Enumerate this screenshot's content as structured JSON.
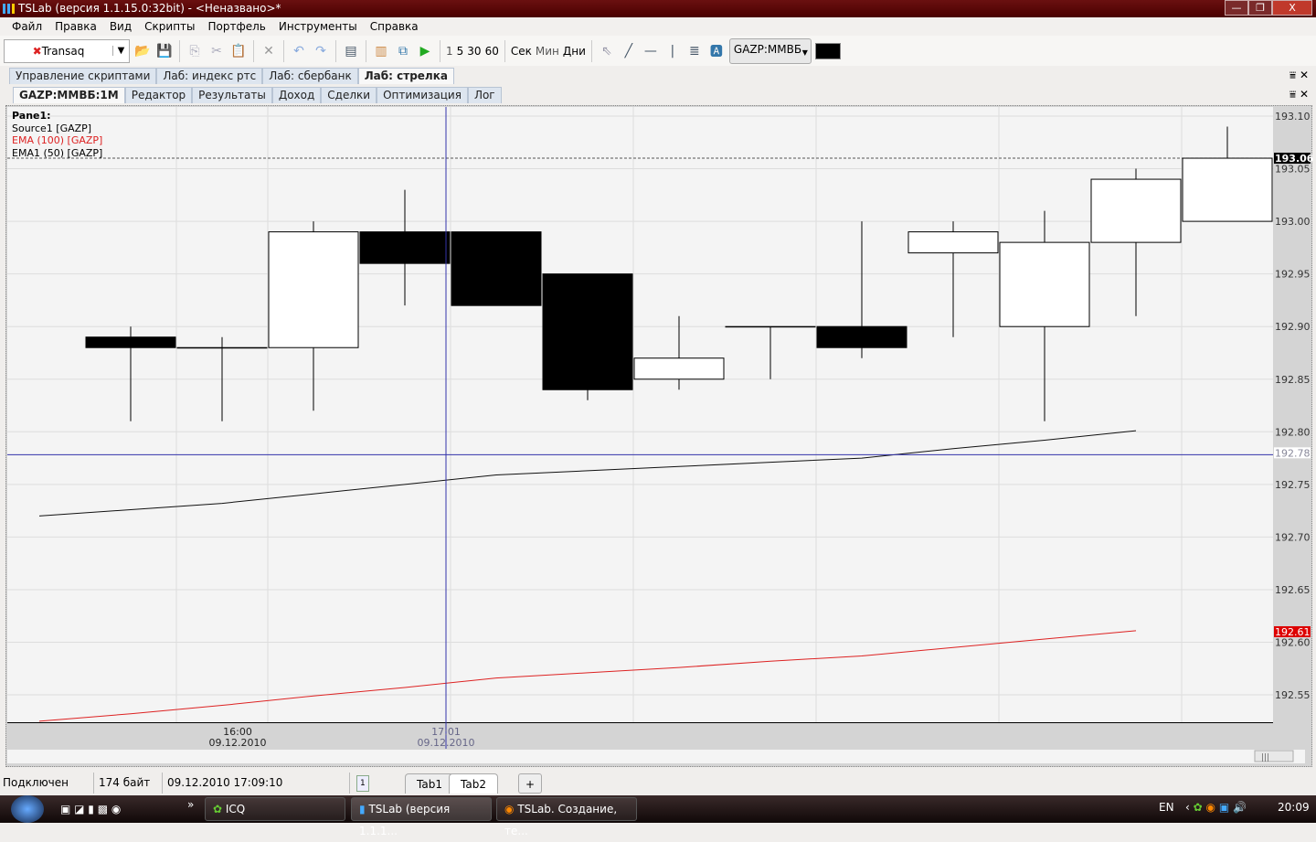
{
  "window": {
    "title": "TSLab (версия 1.1.15.0:32bit) - <Неназвано>*",
    "min": "—",
    "restore": "❐",
    "close": "X"
  },
  "menu": [
    "Файл",
    "Правка",
    "Вид",
    "Скрипты",
    "Портфель",
    "Инструменты",
    "Справка"
  ],
  "toolbar": {
    "connection": "Transaq",
    "intervals": [
      "1",
      "5",
      "30",
      "60"
    ],
    "units": [
      "Сек",
      "Мин",
      "Дни"
    ],
    "symbol": "GAZP:MMBБ",
    "color": "#000000"
  },
  "tabs": [
    "Управление скриптами",
    "Лаб: индекс ртс",
    "Лаб: сбербанк",
    "Лаб: стрелка"
  ],
  "subtabs": [
    "GAZP:MMBБ:1M",
    "Редактор",
    "Результаты",
    "Доход",
    "Сделки",
    "Оптимизация",
    "Лог"
  ],
  "pane_controls": {
    "pin": "⩸",
    "close": "✕"
  },
  "legend": {
    "pane": "Pane1:",
    "source": "Source1 [GAZP]",
    "ema100": "EMA (100) [GAZP]",
    "ema50": "EMA1 (50) [GAZP]"
  },
  "chart_data": {
    "type": "candlestick",
    "ylim": [
      192.52,
      193.11
    ],
    "yticks": [
      "193.10",
      "193.05",
      "193.00",
      "192.95",
      "192.90",
      "192.85",
      "192.80",
      "192.75",
      "192.70",
      "192.65",
      "192.60",
      "192.55"
    ],
    "last_price": "193.06",
    "ema50_label": "192.78",
    "ema100_label": "192.61",
    "candles": [
      {
        "o": 192.89,
        "h": 192.9,
        "l": 192.81,
        "c": 192.88
      },
      {
        "o": 192.88,
        "h": 192.89,
        "l": 192.81,
        "c": 192.88
      },
      {
        "o": 192.88,
        "h": 193.0,
        "l": 192.82,
        "c": 192.99
      },
      {
        "o": 192.99,
        "h": 193.03,
        "l": 192.92,
        "c": 192.96
      },
      {
        "o": 192.99,
        "h": 192.99,
        "l": 192.92,
        "c": 192.92
      },
      {
        "o": 192.95,
        "h": 192.95,
        "l": 192.83,
        "c": 192.84
      },
      {
        "o": 192.85,
        "h": 192.91,
        "l": 192.84,
        "c": 192.87
      },
      {
        "o": 192.9,
        "h": 192.9,
        "l": 192.85,
        "c": 192.9
      },
      {
        "o": 192.9,
        "h": 193.0,
        "l": 192.87,
        "c": 192.88
      },
      {
        "o": 192.97,
        "h": 193.0,
        "l": 192.89,
        "c": 192.99
      },
      {
        "o": 192.9,
        "h": 193.01,
        "l": 192.81,
        "c": 192.98
      },
      {
        "o": 192.98,
        "h": 193.05,
        "l": 192.91,
        "c": 193.04
      },
      {
        "o": 193.0,
        "h": 193.09,
        "l": 193.0,
        "c": 193.06
      }
    ],
    "ema50": [
      192.72,
      192.726,
      192.732,
      192.741,
      192.75,
      192.759,
      192.763,
      192.767,
      192.771,
      192.775,
      192.784,
      192.792,
      192.801
    ],
    "ema100": [
      192.525,
      192.532,
      192.54,
      192.549,
      192.557,
      192.566,
      192.571,
      192.576,
      192.582,
      192.587,
      192.595,
      192.603,
      192.611
    ],
    "xticks": [
      {
        "time": "16:00",
        "date": "09.12.2010",
        "index": 1
      },
      {
        "time": "17:01",
        "date": "09.12.2010",
        "index": 4.45
      }
    ],
    "crosshair": {
      "index": 4.45,
      "price": 192.78
    }
  },
  "status": {
    "state": "Подключен",
    "bytes": "174 байт",
    "datetime": "09.12.2010 17:09:10",
    "page": "1",
    "tabs": [
      "Tab1",
      "Tab2"
    ],
    "add": "+"
  },
  "taskbar": {
    "more": "»",
    "tasks": [
      "ICQ",
      "TSLab (версия 1.1.1...",
      "TSLab. Создание, те..."
    ],
    "lang": "EN",
    "clock": "20:09"
  }
}
